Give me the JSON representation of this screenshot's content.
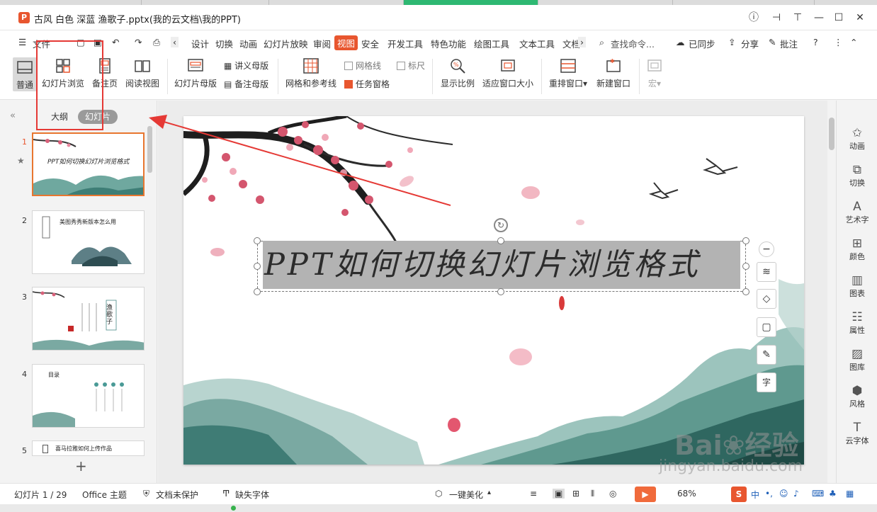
{
  "window": {
    "title": "古风 白色 深蓝 渔歌子.pptx(我的云文档\\我的PPT)",
    "logo_letter": "P"
  },
  "menu": {
    "file": "文件",
    "items": [
      "设计",
      "切换",
      "动画",
      "幻灯片放映",
      "审阅",
      "视图",
      "安全",
      "开发工具",
      "特色功能",
      "绘图工具",
      "文本工具",
      "文档"
    ],
    "search": "查找命令...",
    "synced": "已同步",
    "share": "分享",
    "comment": "批注",
    "help": "?"
  },
  "ribbon": {
    "normal": "普通",
    "slide_browse": "幻灯片浏览",
    "notes_page": "备注页",
    "reading_view": "阅读视图",
    "slide_master": "幻灯片母版",
    "handout_master": "讲义母版",
    "notes_master": "备注母版",
    "grid_guides": "网格和参考线",
    "gridlines": "网格线",
    "ruler": "标尺",
    "task_pane": "任务窗格",
    "zoom": "显示比例",
    "fit_window": "适应窗口大小",
    "arrange": "重排窗口",
    "new_window": "新建窗口",
    "macro": "宏"
  },
  "left_panel": {
    "tab_outline": "大纲",
    "tab_slides": "幻灯片",
    "thumbs": [
      {
        "num": "1",
        "title": "PPT如何切换幻灯片浏览格式"
      },
      {
        "num": "2",
        "title": "美图秀秀新版本怎么用"
      },
      {
        "num": "3",
        "title": "渔歌子"
      },
      {
        "num": "4",
        "title": "目录"
      },
      {
        "num": "5",
        "title": "喜马拉雅如何上传作品"
      }
    ],
    "add": "+"
  },
  "slide": {
    "title": "PPT如何切换幻灯片浏览格式"
  },
  "right_panel": {
    "items": [
      "动画",
      "切换",
      "艺术字",
      "颜色",
      "图表",
      "属性",
      "图库",
      "风格",
      "云字体"
    ]
  },
  "status": {
    "slide_count": "幻灯片 1 / 29",
    "theme": "Office 主题",
    "protect": "文档未保护",
    "missing_font": "缺失字体",
    "beautify": "一键美化",
    "zoom": "68%",
    "ime": "中"
  },
  "watermark": {
    "brand": "Bai",
    "brand2": "经验",
    "url": "jingyan.baidu.com"
  },
  "colors": {
    "accent": "#e8562f",
    "annotation_red": "#e53935"
  }
}
